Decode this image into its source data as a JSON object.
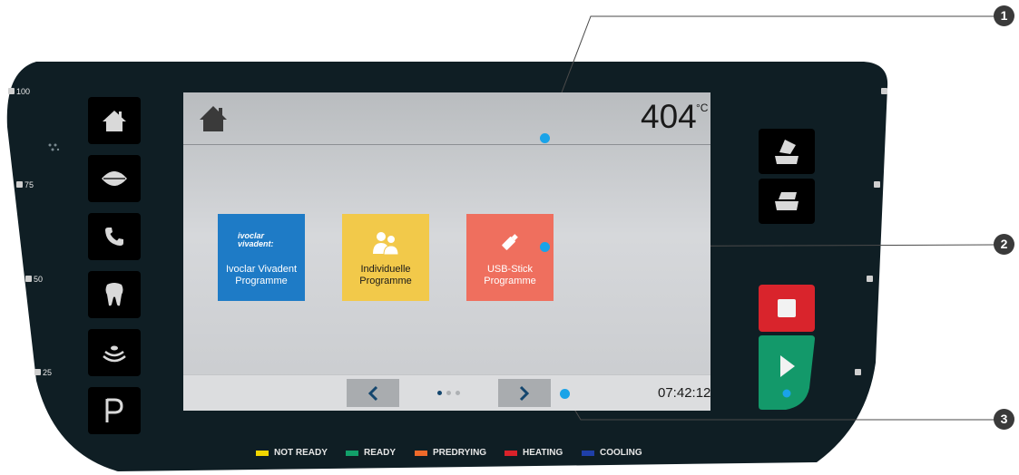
{
  "scale": {
    "labels": [
      "100",
      "75",
      "50",
      "25"
    ]
  },
  "screen": {
    "temperature": "404",
    "temperature_unit": "°C",
    "tiles": [
      {
        "logo": "ivoclar vivadent:",
        "label_line1": "Ivoclar Vivadent",
        "label_line2": "Programme",
        "color": "#1e7bc6",
        "icon": "ivoclar-logo-icon"
      },
      {
        "label_line1": "Individuelle",
        "label_line2": "Programme",
        "color": "#f2c94a",
        "icon": "users-icon"
      },
      {
        "label_line1": "USB-Stick",
        "label_line2": "Programme",
        "color": "#ef6f5e",
        "icon": "usb-stick-icon"
      }
    ],
    "clock": "07:42:12",
    "page_dots": 3,
    "active_page": 1
  },
  "callouts": [
    "1",
    "2",
    "3"
  ],
  "legend": [
    {
      "label": "NOT READY",
      "color": "#f2d600"
    },
    {
      "label": "READY",
      "color": "#12a06a"
    },
    {
      "label": "PREDRYING",
      "color": "#ef6a2a"
    },
    {
      "label": "HEATING",
      "color": "#d9222a"
    },
    {
      "label": "COOLING",
      "color": "#1f3fa8"
    }
  ],
  "colors": {
    "device": "#0f1e24",
    "stop": "#d9242c",
    "start": "#13996a",
    "callout_dot": "#1aa3e8"
  }
}
